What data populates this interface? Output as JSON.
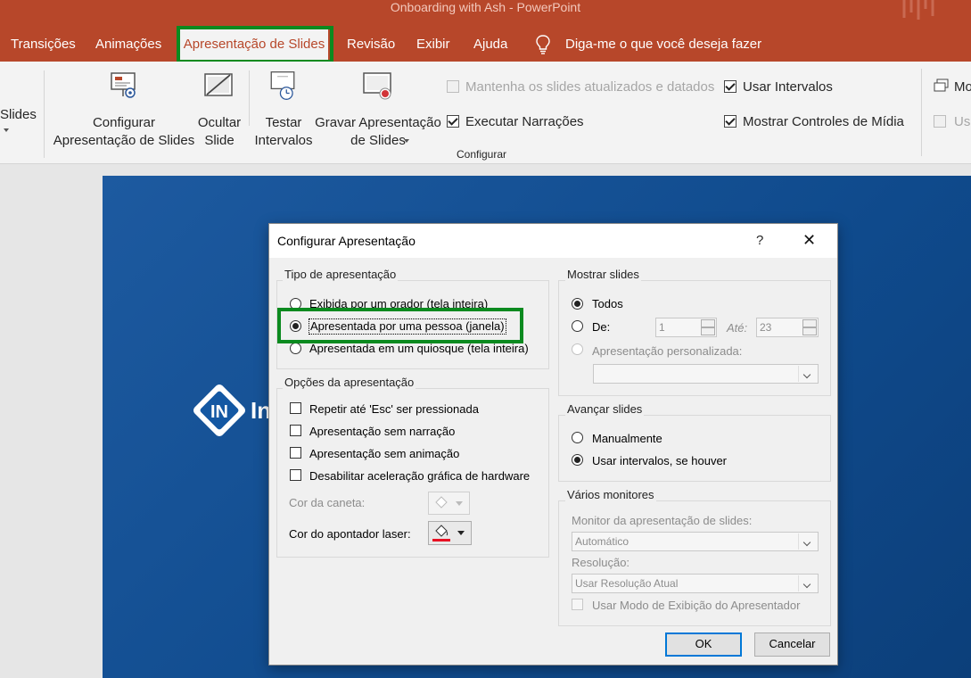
{
  "window": {
    "title": "Onboarding with Ash  -  PowerPoint"
  },
  "tabs": [
    {
      "label": "Transições"
    },
    {
      "label": "Animações"
    },
    {
      "label": "Apresentação de Slides",
      "active": true
    },
    {
      "label": "Revisão"
    },
    {
      "label": "Exibir"
    },
    {
      "label": "Ajuda"
    }
  ],
  "tell_me": {
    "label": "Diga-me o que você deseja fazer",
    "icon": "lightbulb-icon"
  },
  "ribbon": {
    "slides_partial_label": "Slides",
    "configure_show": {
      "line1": "Configurar",
      "line2": "Apresentação de Slides",
      "icon": "setup-slideshow-icon"
    },
    "hide_slide": {
      "line1": "Ocultar",
      "line2": "Slide",
      "icon": "hide-slide-icon"
    },
    "rehearse": {
      "line1": "Testar",
      "line2": "Intervalos",
      "icon": "rehearse-timings-icon"
    },
    "record": {
      "line1": "Gravar Apresentação",
      "line2": "de Slides",
      "icon": "record-slideshow-icon"
    },
    "checks": {
      "keep_updated": {
        "label": "Mantenha os slides atualizados e datados",
        "checked": false,
        "enabled": false
      },
      "play_narrations": {
        "label": "Executar Narrações",
        "checked": true,
        "enabled": true
      },
      "use_timings": {
        "label": "Usar Intervalos",
        "checked": true,
        "enabled": true
      },
      "show_media_controls": {
        "label": "Mostrar Controles de Mídia",
        "checked": true,
        "enabled": true
      }
    },
    "group_label": "Configurar",
    "monitor_partial": "Mo",
    "use_partial": "Usa"
  },
  "slide": {
    "logo_icon": "company-logo-icon",
    "partial_text": "In",
    "background": "#1458a3"
  },
  "dialog": {
    "title": "Configurar Apresentação",
    "help": "?",
    "close": "✕",
    "show_type": {
      "title": "Tipo de apresentação",
      "options": [
        {
          "label": "Exibida por um orador (tela inteira)",
          "selected": false
        },
        {
          "label": "Apresentada por uma pessoa (janela)",
          "selected": true
        },
        {
          "label": "Apresentada em um quiosque (tela inteira)",
          "selected": false
        }
      ]
    },
    "show_options": {
      "title": "Opções da apresentação",
      "checks": [
        {
          "label": "Repetir até 'Esc' ser pressionada",
          "checked": false
        },
        {
          "label": "Apresentação sem narração",
          "checked": false
        },
        {
          "label": "Apresentação sem animação",
          "checked": false
        },
        {
          "label": "Desabilitar aceleração gráfica de hardware",
          "checked": false
        }
      ],
      "pen_color_label": "Cor da caneta:",
      "laser_color_label": "Cor do apontador laser:",
      "laser_color": "#e81123"
    },
    "show_slides": {
      "title": "Mostrar slides",
      "all_label": "Todos",
      "from_label": "De:",
      "from_value": "1",
      "to_label": "Até:",
      "to_value": "23",
      "custom_label": "Apresentação personalizada:",
      "custom_value": ""
    },
    "advance": {
      "title": "Avançar slides",
      "manual_label": "Manualmente",
      "timings_label": "Usar intervalos, se houver"
    },
    "monitors": {
      "title": "Vários monitores",
      "monitor_label": "Monitor da apresentação de slides:",
      "monitor_value": "Automático",
      "resolution_label": "Resolução:",
      "resolution_value": "Usar Resolução Atual",
      "presenter_view_label": "Usar Modo de Exibição do Apresentador"
    },
    "ok_label": "OK",
    "cancel_label": "Cancelar"
  },
  "colors": {
    "accent": "#b7472a",
    "highlight": "#0b8a1f"
  }
}
